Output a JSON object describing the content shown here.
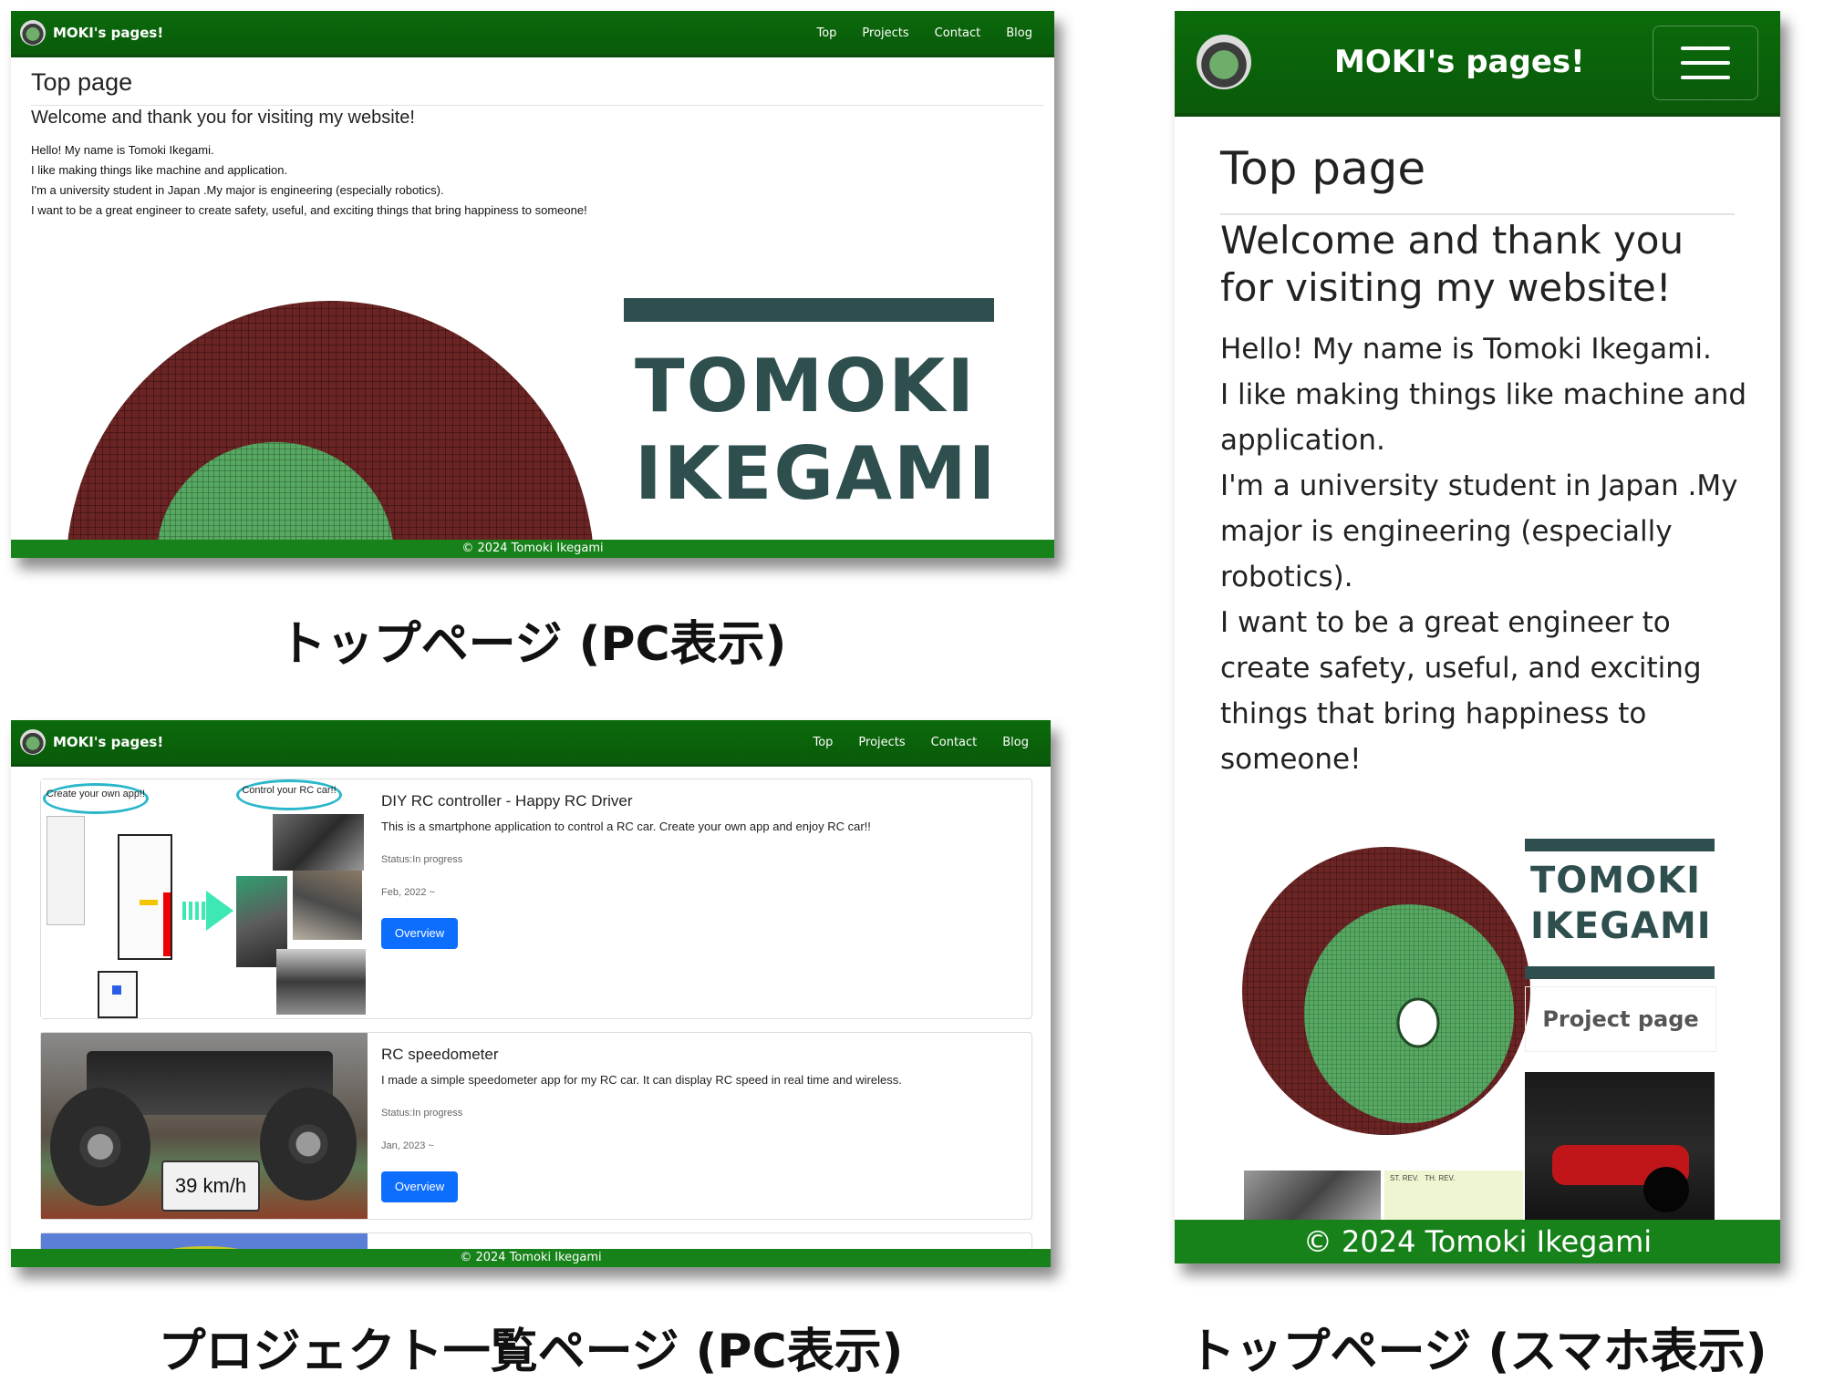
{
  "pc_top": {
    "brand": "MOKI's pages!",
    "nav": [
      "Top",
      "Projects",
      "Contact",
      "Blog"
    ],
    "heading": "Top page",
    "subheading": "Welcome and thank you for visiting my website!",
    "body": [
      "Hello! My name is Tomoki Ikegami.",
      "I like making things like machine and application.",
      "I'm a university student in Japan .My major is engineering (especially robotics).",
      "I want to be a great engineer to create safety, useful, and exciting things that bring happiness to someone!"
    ],
    "banner_line1": "TOMOKI",
    "banner_line2": "IKEGAMI",
    "footer": "© 2024 Tomoki Ikegami"
  },
  "pc_projects": {
    "brand": "MOKI's pages!",
    "nav": [
      "Top",
      "Projects",
      "Contact",
      "Blog"
    ],
    "cards": [
      {
        "title": "DIY RC controller - Happy RC Driver",
        "desc": "This is a smartphone application to control a RC car. Create your own app and enjoy RC car!!",
        "status": "Status:In progress",
        "date": "Feb, 2022 ~",
        "button": "Overview",
        "bubble1": "Create your own app!!",
        "bubble2": "Control your RC car!!"
      },
      {
        "title": "RC speedometer",
        "desc": "I made a simple speedometer app for my RC car. It can display RC speed in real time and wireless.",
        "status": "Status:In progress",
        "date": "Jan, 2023 ~",
        "button": "Overview",
        "speed": "39 km/h"
      }
    ],
    "footer": "© 2024 Tomoki Ikegami"
  },
  "mobile_top": {
    "brand": "MOKI's pages!",
    "heading": "Top page",
    "subheading": "Welcome and thank you for visiting my website!",
    "body": [
      "Hello! My name is Tomoki Ikegami.",
      "I like making things like machine and application.",
      "I'm a university student in Japan .My major is engineering (especially robotics).",
      "I want to be a great engineer to create safety, useful, and exciting things that bring happiness to someone!"
    ],
    "banner_line1": "TOMOKI",
    "banner_line2": "IKEGAMI",
    "project_link": "Project page",
    "chip_label": "ST. REV.   TH. REV.",
    "footer": "© 2024 Tomoki Ikegami"
  },
  "captions": {
    "pc_top": "トップページ (PC表示)",
    "pc_projects": "プロジェクト一覧ページ (PC表示)",
    "mobile_top": "トップページ (スマホ表示)"
  }
}
